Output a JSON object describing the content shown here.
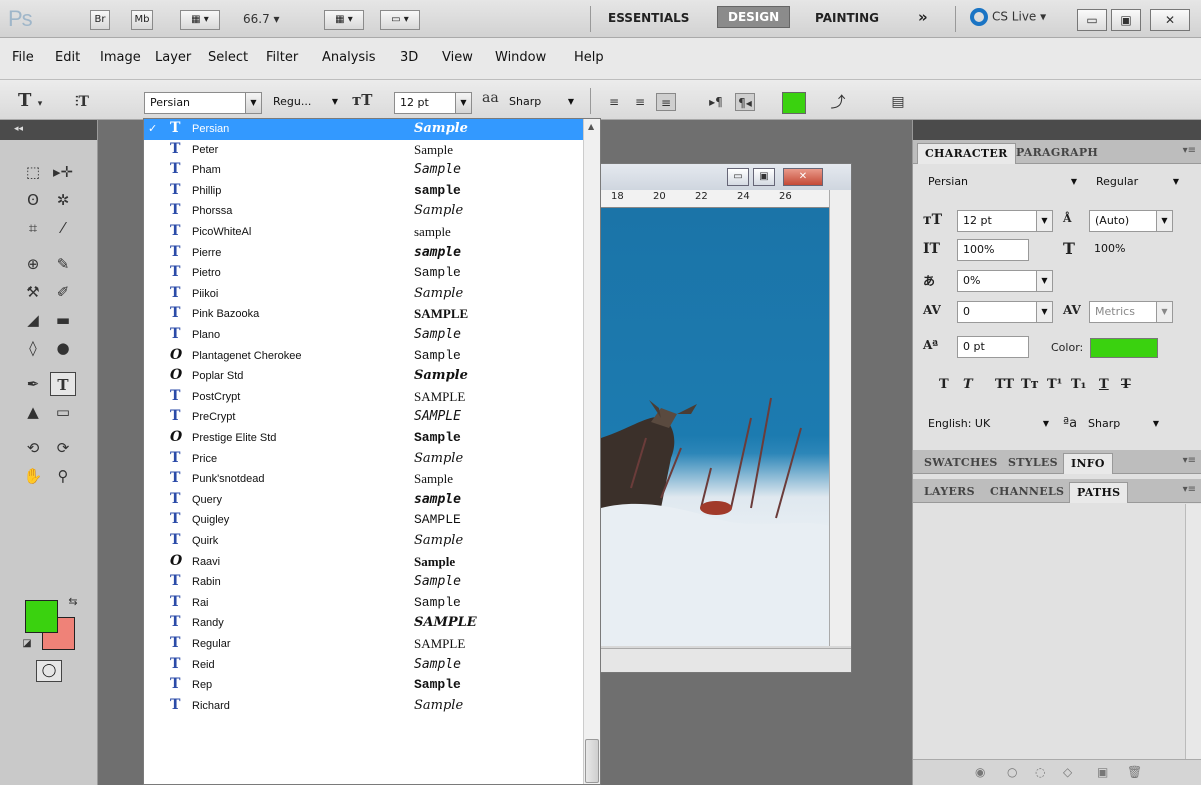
{
  "appbar": {
    "logo": "Ps",
    "bridge": "Br",
    "minibridge": "Mb",
    "zoom": "66.7",
    "workspaces": [
      "ESSENTIALS",
      "DESIGN",
      "PAINTING"
    ],
    "more": "»",
    "cslive": "CS Live"
  },
  "menu": [
    "File",
    "Edit",
    "Image",
    "Layer",
    "Select",
    "Filter",
    "Analysis",
    "3D",
    "View",
    "Window",
    "Help"
  ],
  "options": {
    "tool_label": "T",
    "font_family": "Persian",
    "font_style": "Regu...",
    "font_size": "12 pt",
    "aa_label": "a",
    "aa_mode": "Sharp",
    "text_color": "#3ad20f"
  },
  "font_list": [
    {
      "name": "Persian",
      "sample": "Sample",
      "type": "tt",
      "selected": true
    },
    {
      "name": "Peter",
      "sample": "Sample",
      "type": "tt"
    },
    {
      "name": "Pham",
      "sample": "Sample",
      "type": "tt"
    },
    {
      "name": "Phillip",
      "sample": "sample",
      "type": "tt"
    },
    {
      "name": "Phorssa",
      "sample": "Sample",
      "type": "tt"
    },
    {
      "name": "PicoWhiteAl",
      "sample": "sample",
      "type": "tt"
    },
    {
      "name": "Pierre",
      "sample": "sample",
      "type": "tt"
    },
    {
      "name": "Pietro",
      "sample": "Sample",
      "type": "tt"
    },
    {
      "name": "Piikoi",
      "sample": "Sample",
      "type": "tt"
    },
    {
      "name": "Pink Bazooka",
      "sample": "SAMPLE",
      "type": "tt"
    },
    {
      "name": "Plano",
      "sample": "Sample",
      "type": "tt"
    },
    {
      "name": "Plantagenet Cherokee",
      "sample": "Sample",
      "type": "otf"
    },
    {
      "name": "Poplar Std",
      "sample": "Sample",
      "type": "otf"
    },
    {
      "name": "PostCrypt",
      "sample": "SAMPLE",
      "type": "tt"
    },
    {
      "name": "PreCrypt",
      "sample": "SAMPLE",
      "type": "tt"
    },
    {
      "name": "Prestige Elite Std",
      "sample": "Sample",
      "type": "otf"
    },
    {
      "name": "Price",
      "sample": "Sample",
      "type": "tt"
    },
    {
      "name": "Punk'snotdead",
      "sample": "Sample",
      "type": "tt"
    },
    {
      "name": "Query",
      "sample": "sample",
      "type": "tt"
    },
    {
      "name": "Quigley",
      "sample": "SAMPLE",
      "type": "tt"
    },
    {
      "name": "Quirk",
      "sample": "Sample",
      "type": "tt"
    },
    {
      "name": "Raavi",
      "sample": "Sample",
      "type": "otf"
    },
    {
      "name": "Rabin",
      "sample": "Sample",
      "type": "tt"
    },
    {
      "name": "Rai",
      "sample": "Sample",
      "type": "tt"
    },
    {
      "name": "Randy",
      "sample": "SAMPLE",
      "type": "tt"
    },
    {
      "name": "Regular",
      "sample": "SAMPLE",
      "type": "tt"
    },
    {
      "name": "Reid",
      "sample": "Sample",
      "type": "tt"
    },
    {
      "name": "Rep",
      "sample": "Sample",
      "type": "tt"
    },
    {
      "name": "Richard",
      "sample": "Sample",
      "type": "tt"
    }
  ],
  "ruler": [
    "18",
    "20",
    "22",
    "24",
    "26"
  ],
  "character_panel": {
    "tabs": [
      "CHARACTER",
      "PARAGRAPH"
    ],
    "font_family": "Persian",
    "font_style": "Regular",
    "size": "12 pt",
    "leading": "(Auto)",
    "vscale": "100%",
    "hscale": "100%",
    "tsume": "0%",
    "tracking": "0",
    "kerning": "Metrics",
    "baseline": "0 pt",
    "color_label": "Color:",
    "color": "#3ad20f",
    "language": "English: UK",
    "aa_mode": "Sharp"
  },
  "swatch_tabs": [
    "SWATCHES",
    "STYLES",
    "INFO"
  ],
  "layer_tabs": [
    "LAYERS",
    "CHANNELS",
    "PATHS"
  ]
}
